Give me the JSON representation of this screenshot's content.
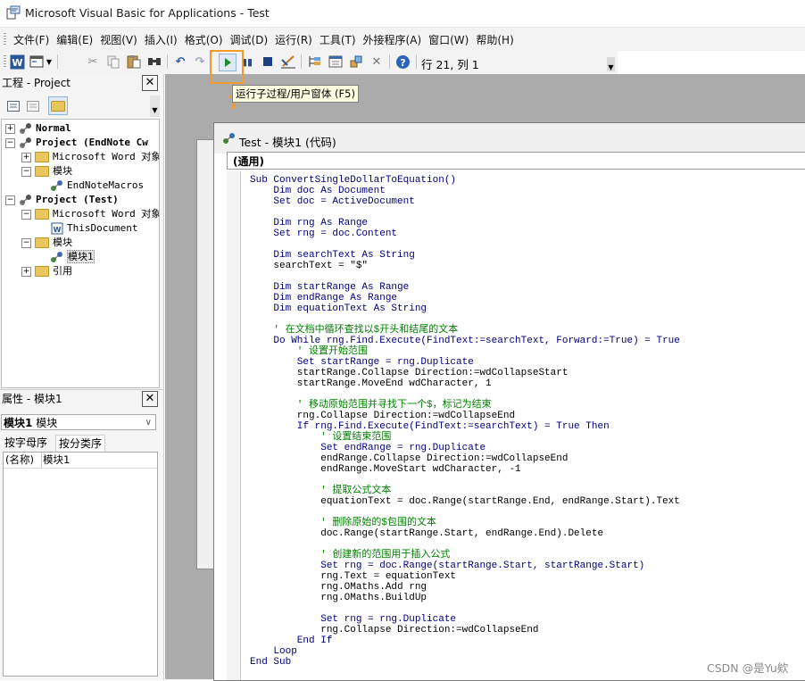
{
  "window": {
    "title": "Microsoft Visual Basic for Applications - Test"
  },
  "menu": [
    "文件(F)",
    "编辑(E)",
    "视图(V)",
    "插入(I)",
    "格式(O)",
    "调试(D)",
    "运行(R)",
    "工具(T)",
    "外接程序(A)",
    "窗口(W)",
    "帮助(H)"
  ],
  "toolbar": {
    "cursor_position": "行 21, 列 1",
    "tooltip": "运行子过程/用户窗体 (F5)",
    "icons": [
      "word-icon",
      "insert-userform-icon",
      "dropdown-arrow-icon",
      "cut-icon",
      "copy-icon",
      "paste-icon",
      "find-icon",
      "undo-icon",
      "redo-icon",
      "run-icon",
      "break-icon",
      "reset-icon",
      "design-mode-icon",
      "project-explorer-icon",
      "properties-window-icon",
      "object-browser-icon",
      "toolbox-icon",
      "help-icon"
    ]
  },
  "project_panel": {
    "title": "工程 - Project",
    "close": "✕",
    "tree": [
      {
        "label": "Normal",
        "bold": true,
        "level": 0,
        "expander": "+"
      },
      {
        "label": "Project (EndNote Cw",
        "bold": true,
        "level": 0,
        "expander": "−"
      },
      {
        "label": "Microsoft Word 对象",
        "level": 1,
        "expander": "+"
      },
      {
        "label": "模块",
        "level": 1,
        "expander": "−"
      },
      {
        "label": "EndNoteMacros",
        "level": 2
      },
      {
        "label": "Project (Test)",
        "bold": true,
        "level": 0,
        "expander": "−"
      },
      {
        "label": "Microsoft Word 对象",
        "level": 1,
        "expander": "−"
      },
      {
        "label": "ThisDocument",
        "level": 2
      },
      {
        "label": "模块",
        "level": 1,
        "expander": "−"
      },
      {
        "label": "模块1",
        "level": 2,
        "selected": true
      },
      {
        "label": "引用",
        "level": 1,
        "expander": "+"
      }
    ]
  },
  "properties_panel": {
    "title": "属性 - 模块1",
    "close": "✕",
    "object_name": "模块1",
    "object_type": "模块",
    "tabs": [
      "按字母序",
      "按分类序"
    ],
    "rows": [
      {
        "key": "(名称)",
        "value": "模块1"
      }
    ]
  },
  "code_window": {
    "title": "Test - 模块1 (代码)",
    "object_combo": "(通用)",
    "lines": [
      {
        "t": "Sub ConvertSingleDollarToEquation()",
        "k": true
      },
      {
        "t": "    Dim doc As Document",
        "k": true
      },
      {
        "t": "    Set doc = ActiveDocument",
        "k": true
      },
      {
        "t": ""
      },
      {
        "t": "    Dim rng As Range",
        "k": true
      },
      {
        "t": "    Set rng = doc.Content",
        "k": true
      },
      {
        "t": ""
      },
      {
        "t": "    Dim searchText As String",
        "k": true
      },
      {
        "t": "    searchText = \"$\""
      },
      {
        "t": ""
      },
      {
        "t": "    Dim startRange As Range",
        "k": true
      },
      {
        "t": "    Dim endRange As Range",
        "k": true
      },
      {
        "t": "    Dim equationText As String",
        "k": true
      },
      {
        "t": ""
      },
      {
        "t": "    ' 在文档中循环查找以$开头和结尾的文本",
        "c": true
      },
      {
        "t": "    Do While rng.Find.Execute(FindText:=searchText, Forward:=True) = True",
        "k": true
      },
      {
        "t": "        ' 设置开始范围",
        "c": true
      },
      {
        "t": "        Set startRange = rng.Duplicate",
        "k": true
      },
      {
        "t": "        startRange.Collapse Direction:=wdCollapseStart"
      },
      {
        "t": "        startRange.MoveEnd wdCharacter, 1"
      },
      {
        "t": ""
      },
      {
        "t": "        ' 移动原始范围并寻找下一个$，标记为结束",
        "c": true
      },
      {
        "t": "        rng.Collapse Direction:=wdCollapseEnd"
      },
      {
        "t": "        If rng.Find.Execute(FindText:=searchText) = True Then",
        "k": true
      },
      {
        "t": "            ' 设置结束范围",
        "c": true
      },
      {
        "t": "            Set endRange = rng.Duplicate",
        "k": true
      },
      {
        "t": "            endRange.Collapse Direction:=wdCollapseEnd"
      },
      {
        "t": "            endRange.MoveStart wdCharacter, -1"
      },
      {
        "t": ""
      },
      {
        "t": "            ' 提取公式文本",
        "c": true
      },
      {
        "t": "            equationText = doc.Range(startRange.End, endRange.Start).Text"
      },
      {
        "t": ""
      },
      {
        "t": "            ' 删除原始的$包围的文本",
        "c": true
      },
      {
        "t": "            doc.Range(startRange.Start, endRange.End).Delete"
      },
      {
        "t": ""
      },
      {
        "t": "            ' 创建新的范围用于插入公式",
        "c": true
      },
      {
        "t": "            Set rng = doc.Range(startRange.Start, startRange.Start)",
        "k": true
      },
      {
        "t": "            rng.Text = equationText"
      },
      {
        "t": "            rng.OMaths.Add rng"
      },
      {
        "t": "            rng.OMaths.BuildUp"
      },
      {
        "t": ""
      },
      {
        "t": "            Set rng = rng.Duplicate",
        "k": true
      },
      {
        "t": "            rng.Collapse Direction:=wdCollapseEnd"
      },
      {
        "t": "        End If",
        "k": true
      },
      {
        "t": "    Loop",
        "k": true
      },
      {
        "t": "End Sub",
        "k": true
      }
    ]
  },
  "watermark": "CSDN @是Yu欸",
  "colors": {
    "highlight": "#f39a2b",
    "keyword": "#00007f",
    "comment": "#007f00",
    "tooltip_bg": "#ffffe1",
    "mdi_bg": "#ababab"
  }
}
